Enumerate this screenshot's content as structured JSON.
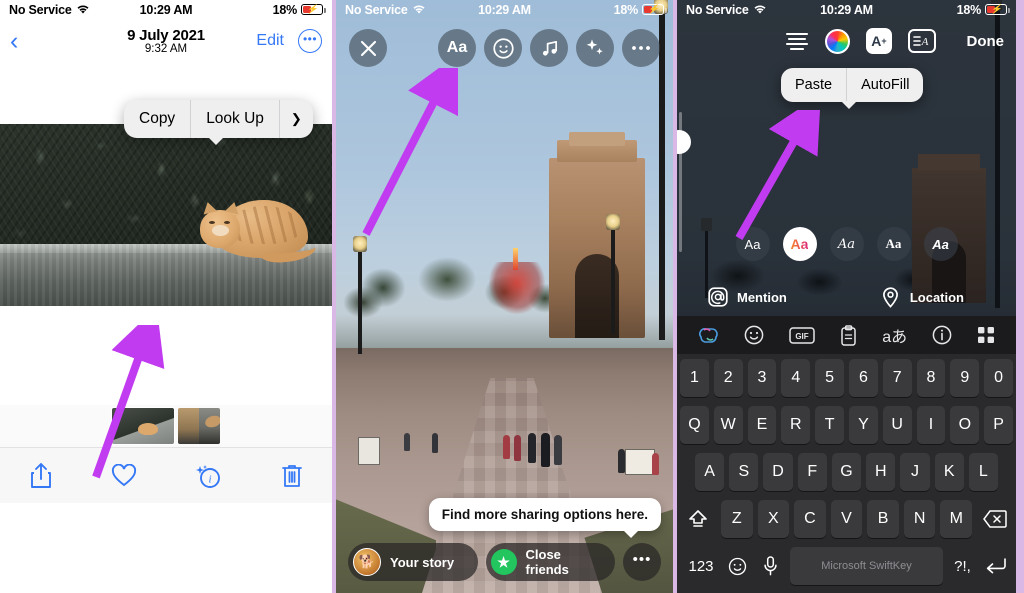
{
  "panel1": {
    "status": {
      "carrier": "No Service",
      "time": "10:29 AM",
      "battery": "18%",
      "wifi_icon": "wifi-icon",
      "battery_icon": "battery-charging-icon"
    },
    "navbar": {
      "back_icon": "chevron-left-icon",
      "date": "9 July 2021",
      "time": "9:32 AM",
      "edit_label": "Edit",
      "more_icon": "ellipsis-circle-icon"
    },
    "context_menu": {
      "copy_label": "Copy",
      "lookup_label": "Look Up",
      "chevron_icon": "chevron-right-icon"
    },
    "toolbar": {
      "share_icon": "share-icon",
      "favorite_icon": "heart-icon",
      "info_icon": "info-sparkle-icon",
      "delete_icon": "trash-icon"
    },
    "thumbnails": [
      "cat-on-ledge-thumbnail",
      "paired-photo-thumbnail"
    ]
  },
  "panel2": {
    "status": {
      "carrier": "No Service",
      "time": "10:29 AM",
      "battery": "18%",
      "wifi_icon": "wifi-icon",
      "battery_icon": "battery-charging-icon"
    },
    "topbar": {
      "close_icon": "close-x-icon",
      "text_label": "Aa",
      "sticker_icon": "sticker-smiley-icon",
      "music_icon": "music-note-icon",
      "effects_icon": "sparkles-icon",
      "more_icon": "ellipsis-icon"
    },
    "tooltip": "Find more sharing options here.",
    "share": {
      "your_story_label": "Your story",
      "close_friends_label": "Close friends",
      "avatar_icon": "profile-avatar",
      "star_icon": "close-friends-star-icon",
      "more_icon": "ellipsis-icon"
    }
  },
  "panel3": {
    "status": {
      "carrier": "No Service",
      "time": "10:29 AM",
      "battery": "18%",
      "wifi_icon": "wifi-icon",
      "battery_icon": "battery-charging-icon"
    },
    "topbar": {
      "align_icon": "text-align-icon",
      "color_icon": "color-wheel-icon",
      "text_effect_label": "A",
      "text_effect_icon": "text-animation-icon",
      "highlight_icon": "text-highlight-icon",
      "done_label": "Done"
    },
    "edit_menu": {
      "paste_label": "Paste",
      "autofill_label": "AutoFill"
    },
    "fonts": [
      {
        "label": "Aa",
        "style": "classic",
        "selected": false
      },
      {
        "label": "Aa",
        "style": "modern",
        "selected": true
      },
      {
        "label": "Aa",
        "style": "neon-script",
        "selected": false
      },
      {
        "label": "Aa",
        "style": "typewriter",
        "selected": false
      },
      {
        "label": "Aa",
        "style": "strong",
        "selected": false
      }
    ],
    "actions": {
      "mention_label": "Mention",
      "mention_icon": "at-sign-icon",
      "location_label": "Location",
      "location_icon": "location-pin-icon"
    },
    "keyboard": {
      "toolbar_icons": [
        "copilot-icon",
        "emoji-icon",
        "gif-icon",
        "clipboard-icon",
        "translate-icon",
        "info-icon",
        "grid-menu-icon"
      ],
      "gif_label": "GIF",
      "translate_label": "aあ",
      "row_numbers": [
        "1",
        "2",
        "3",
        "4",
        "5",
        "6",
        "7",
        "8",
        "9",
        "0"
      ],
      "row_top": [
        "Q",
        "W",
        "E",
        "R",
        "T",
        "Y",
        "U",
        "I",
        "O",
        "P"
      ],
      "row_home": [
        "A",
        "S",
        "D",
        "F",
        "G",
        "H",
        "J",
        "K",
        "L"
      ],
      "row_bottom": [
        "Z",
        "X",
        "C",
        "V",
        "B",
        "N",
        "M"
      ],
      "shift_icon": "shift-icon",
      "backspace_icon": "backspace-icon",
      "numeric_label": "123",
      "emoji_icon": "emoji-icon",
      "mic_icon": "microphone-icon",
      "space_label": "Microsoft SwiftKey",
      "punctuation_label": "?!,",
      "return_icon": "return-icon"
    }
  },
  "annotations": {
    "arrow_color": "#c13bf0"
  }
}
